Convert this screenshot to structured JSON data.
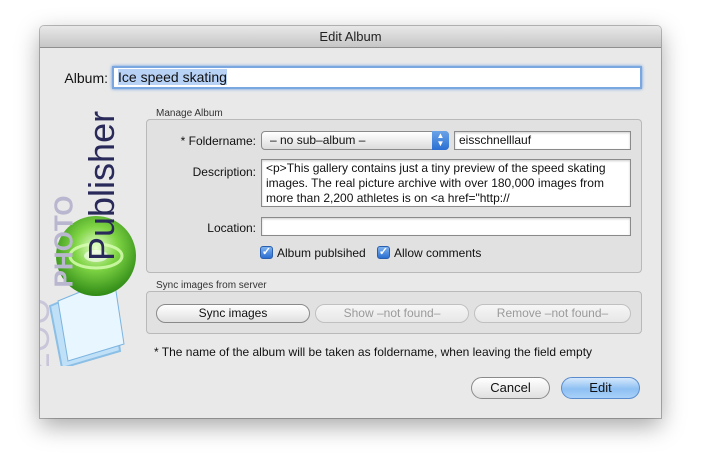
{
  "window": {
    "title": "Edit Album"
  },
  "album": {
    "label": "Album:",
    "value": "Ice speed skating"
  },
  "manage": {
    "group_title": "Manage Album",
    "foldername_label": "* Foldername:",
    "foldername_popup": "– no sub–album –",
    "foldername_value": "eisschnelllauf",
    "description_label": "Description:",
    "description_lines": [
      "<p>This gallery contains just a tiny preview of the speed skating",
      "images. The real picture archive with over 180,000 images from",
      "more than 2,200 athletes is on <a href=\"http://"
    ],
    "location_label": "Location:",
    "location_value": "",
    "published_label": "Album publsihed",
    "published_checked": true,
    "comments_label": "Allow comments",
    "comments_checked": true
  },
  "sync": {
    "group_title": "Sync images from server",
    "sync_button": "Sync images",
    "show_button": "Show –not found–",
    "remove_button": "Remove –not found–"
  },
  "footnote": "*  The name of the album will be taken as foldername, when leaving the field empty",
  "buttons": {
    "cancel": "Cancel",
    "edit": "Edit"
  },
  "logo": {
    "text_zoo": "ZOO",
    "text_photo": "PHOTO",
    "text_publisher": "Publisher"
  },
  "colors": {
    "accent": "#2a6fd2",
    "logo_dark": "#2a2a5a",
    "logo_light": "#b9b6cf",
    "logo_green": "#5cbf2a"
  }
}
